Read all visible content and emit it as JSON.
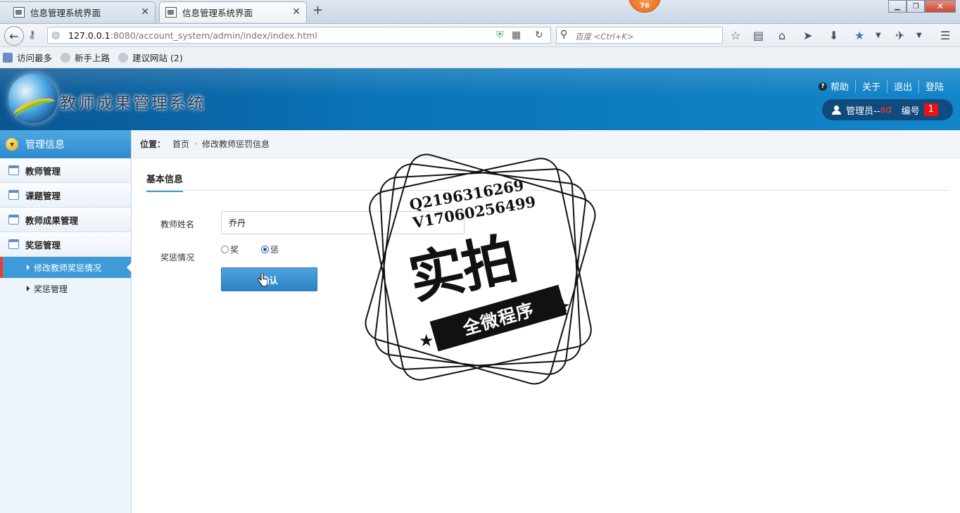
{
  "browser": {
    "tabs": [
      {
        "label": "信息管理系统界面",
        "active": false
      },
      {
        "label": "信息管理系统界面",
        "active": true
      }
    ],
    "notification_count": "76",
    "url_host": "127.0.0.1",
    "url_rest": ":8080/account_system/admin/index/index.html",
    "search_placeholder": "百度 <Ctrl+K>",
    "bookmarks": [
      "访问最多",
      "新手上路",
      "建议网站 (2)"
    ]
  },
  "header": {
    "title": "教师成果管理系统",
    "links": [
      "帮助",
      "关于",
      "退出",
      "登陆"
    ],
    "user_prefix": "管理员--",
    "user_name": "ad",
    "id_label": "编号",
    "id_value": "1",
    "colors": {
      "header_bg": "#0a74b8",
      "accent": "#3f9ad8",
      "badge": "#ee1111"
    }
  },
  "sidebar": {
    "header": "管理信息",
    "items": [
      "教师管理",
      "课题管理",
      "教师成果管理",
      "奖惩管理"
    ],
    "subitems": [
      {
        "label": "修改教师奖惩情况",
        "active": true
      },
      {
        "label": "奖惩管理",
        "active": false
      }
    ]
  },
  "main": {
    "breadcrumb_label": "位置：",
    "breadcrumb": [
      "首页",
      "修改教师惩罚信息"
    ],
    "section_tab": "基本信息",
    "form": {
      "name_label": "教师姓名",
      "name_value": "乔丹",
      "reward_label": "奖惩情况",
      "options": [
        "奖",
        "惩"
      ],
      "selected": "惩",
      "submit_label": "确认"
    }
  },
  "watermark": {
    "line1": "Q2196316269",
    "line2": "V17060256499",
    "big_text": "实拍",
    "ribbon_text": "全微程序"
  }
}
